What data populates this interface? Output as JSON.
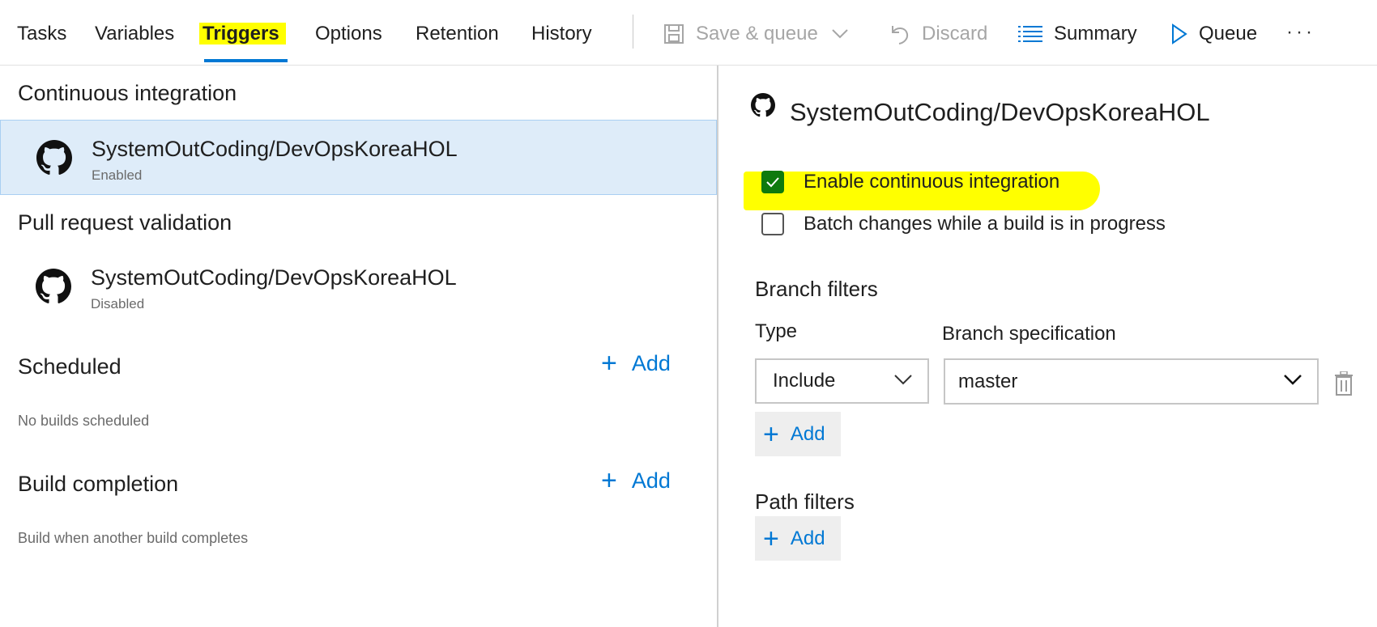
{
  "tabs": [
    {
      "label": "Tasks"
    },
    {
      "label": "Variables"
    },
    {
      "label": "Triggers",
      "active": true
    },
    {
      "label": "Options"
    },
    {
      "label": "Retention"
    },
    {
      "label": "History"
    }
  ],
  "toolbar": {
    "save_queue_label": "Save & queue",
    "discard_label": "Discard",
    "summary_label": "Summary",
    "queue_label": "Queue",
    "more_label": "···"
  },
  "left": {
    "ci": {
      "title": "Continuous integration",
      "repo": "SystemOutCoding/DevOpsKoreaHOL",
      "status": "Enabled"
    },
    "pr": {
      "title": "Pull request validation",
      "repo": "SystemOutCoding/DevOpsKoreaHOL",
      "status": "Disabled"
    },
    "scheduled": {
      "title": "Scheduled",
      "add_label": "Add",
      "hint": "No builds scheduled"
    },
    "build_completion": {
      "title": "Build completion",
      "add_label": "Add",
      "hint": "Build when another build completes"
    }
  },
  "right": {
    "repo_title": "SystemOutCoding/DevOpsKoreaHOL",
    "enable_ci_label": "Enable continuous integration",
    "enable_ci_checked": true,
    "batch_label": "Batch changes while a build is in progress",
    "batch_checked": false,
    "branch_filters": {
      "heading": "Branch filters",
      "type_label": "Type",
      "spec_label": "Branch specification",
      "type_value": "Include",
      "spec_value": "master",
      "add_label": "Add"
    },
    "path_filters": {
      "heading": "Path filters",
      "add_label": "Add"
    }
  },
  "colors": {
    "accent": "#0078d4",
    "highlight": "#ffff00",
    "selected_row": "#deecf9",
    "checkbox_checked": "#0e7a0d"
  },
  "icons": [
    "save-icon",
    "chevron-down-icon",
    "undo-icon",
    "list-icon",
    "play-icon",
    "github-icon",
    "plus-icon",
    "trash-icon",
    "check-icon"
  ]
}
